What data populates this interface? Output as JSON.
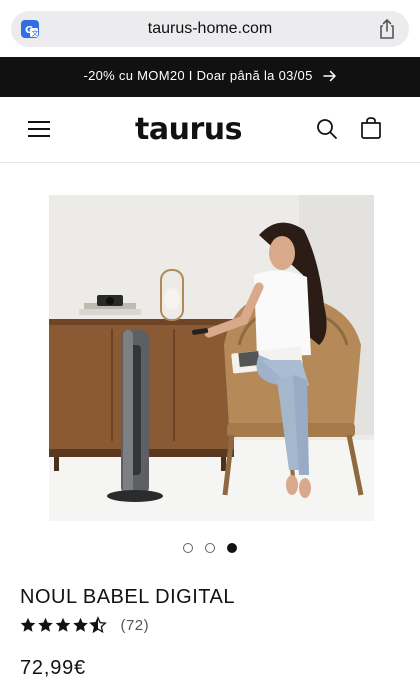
{
  "browser": {
    "url": "taurus-home.com",
    "translate_icon": "translate-icon",
    "share_icon": "share-icon"
  },
  "announcement": {
    "text": "-20% cu MOM20 I Doar până la 03/05",
    "arrow_icon": "arrow-right-icon"
  },
  "header": {
    "menu_icon": "hamburger-menu-icon",
    "logo": "taurus",
    "search_icon": "search-icon",
    "cart_icon": "cart-icon"
  },
  "carousel": {
    "total_slides": 3,
    "active_slide": 3
  },
  "product": {
    "title": "NOUL BABEL DIGITAL",
    "rating_value": 4.5,
    "rating_max": 5,
    "rating_count": "(72)",
    "price": "72,99€"
  },
  "colors": {
    "announcement_bg": "#111111",
    "text": "#121212",
    "url_bar": "#ececee"
  }
}
